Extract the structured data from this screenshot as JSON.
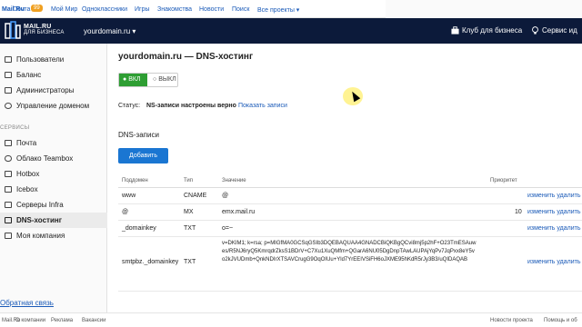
{
  "portal": {
    "links": [
      "Mail.Ru",
      "Почта",
      "Мой Мир",
      "Одноклассники",
      "Игры",
      "Знакомства",
      "Новости",
      "Поиск",
      "Все проекты ▾"
    ],
    "mail_badge": "99"
  },
  "header": {
    "logo_line1": "MAIL.RU",
    "logo_line2": "ДЛЯ БИЗНЕСА",
    "domain": "yourdomain.ru ▾",
    "club": "Клуб для бизнеса",
    "service": "Сервис ид"
  },
  "sidebar": {
    "items": [
      {
        "label": "Пользователи",
        "icon": "users-icon"
      },
      {
        "label": "Баланс",
        "icon": "wallet-icon"
      },
      {
        "label": "Администраторы",
        "icon": "admin-icon"
      },
      {
        "label": "Управление доменом",
        "icon": "globe-icon"
      }
    ],
    "section": "СЕРВИСЫ",
    "services": [
      {
        "label": "Почта",
        "icon": "mail-icon"
      },
      {
        "label": "Облако Teambox",
        "icon": "cloud-icon"
      },
      {
        "label": "Hotbox",
        "icon": "hotbox-icon"
      },
      {
        "label": "Icebox",
        "icon": "icebox-icon"
      },
      {
        "label": "Серверы Infra",
        "icon": "server-icon"
      },
      {
        "label": "DNS-хостинг",
        "icon": "dns-icon",
        "active": true
      },
      {
        "label": "Моя компания",
        "icon": "company-icon"
      }
    ],
    "feedback": "Обратная связь"
  },
  "main": {
    "title": "yourdomain.ru — DNS-хостинг",
    "toggle_on": "ВКЛ",
    "toggle_off": "ВЫКЛ",
    "status_label": "Статус:",
    "status_value": "NS-записи настроены верно",
    "status_link": "Показать записи",
    "dns_title": "DNS-записи",
    "add_button": "Добавить",
    "columns": [
      "Поддомен",
      "Тип",
      "Значение",
      "Приоритет"
    ],
    "rows": [
      {
        "sub": "www",
        "type": "CNAME",
        "value": "@",
        "priority": "",
        "actions": "изменить удалить"
      },
      {
        "sub": "@",
        "type": "MX",
        "value": "emx.mail.ru",
        "priority": "10",
        "actions": "изменить удалить"
      },
      {
        "sub": "_domainkey",
        "type": "TXT",
        "value": "o=~",
        "priority": "",
        "actions": "изменить удалить"
      },
      {
        "sub": "smtpbz._domainkey",
        "type": "TXT",
        "value": "v=DKIM1; k=rsa; p=MIGfMA0GCSqGSIb3DQEBAQUAA4GNADCBiQKBgQCvi8mj5p2hF+O23TmESAuwes/R5NJ6ryQ5KmrqdrZksS1BDrV+C7Xu1XuQMfm+QGarA6NU05DgDnpTAwLAUPAjYqPv7JqPxx8eY5vo2kJVUDmb+QnkNDIrXTSAVCrugG9OqOIUu+Yld7YrEEIVSiFH6oJXME95hKdR5rJy3B3/uQIDAQAB",
        "priority": "",
        "actions": "изменить удалить"
      }
    ]
  },
  "footer": {
    "left": [
      "Mail.Ru",
      "О компании",
      "Реклама",
      "Вакансии"
    ],
    "right": [
      "Новости проекта",
      "Помощь и об"
    ]
  }
}
